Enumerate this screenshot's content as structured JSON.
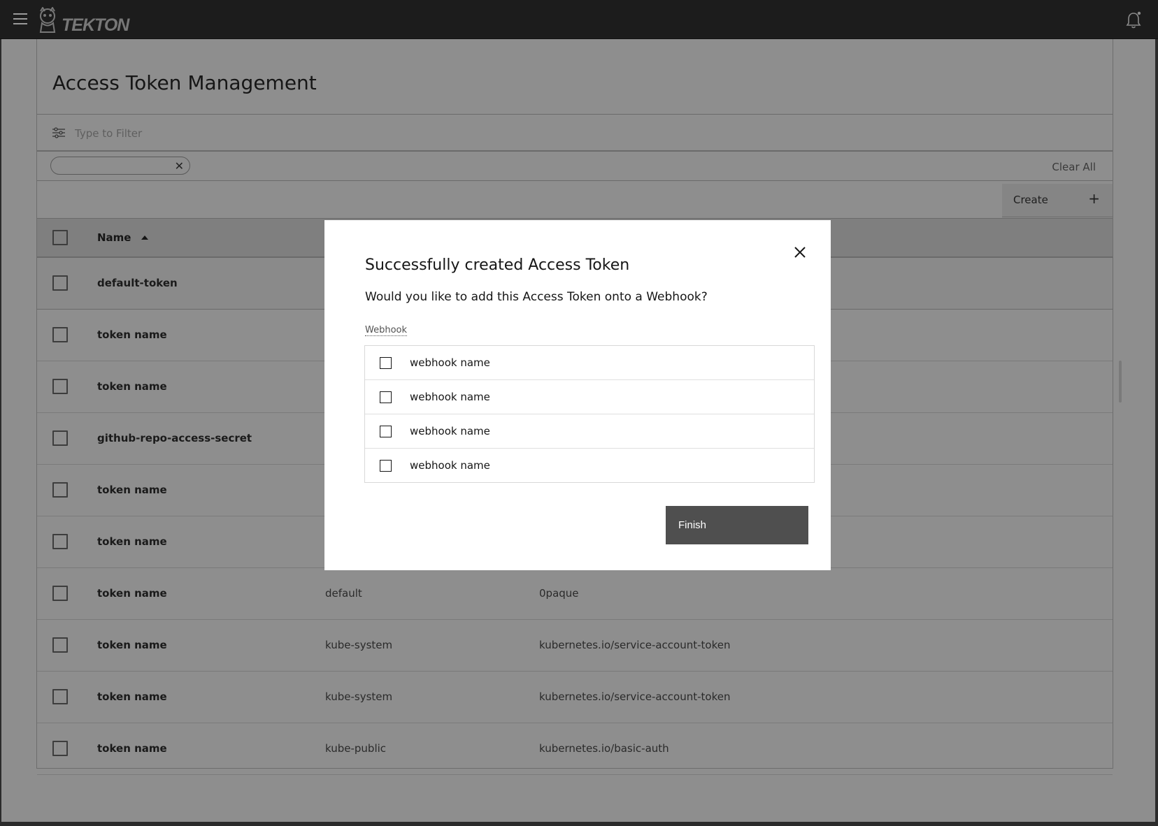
{
  "header": {
    "logo_text": "TEKTON"
  },
  "page": {
    "title": "Access Token Management",
    "filter_placeholder": "Type to Filter",
    "clear_all": "Clear All",
    "create_label": "Create",
    "create_plus": "+",
    "tag_close": "✕"
  },
  "table": {
    "columns": [
      "Name"
    ],
    "rows": [
      {
        "name": "default-token",
        "namespace": "",
        "type": ""
      },
      {
        "name": "token name",
        "namespace": "",
        "type": ""
      },
      {
        "name": "token name",
        "namespace": "",
        "type": ""
      },
      {
        "name": "github-repo-access-secret",
        "namespace": "",
        "type": ""
      },
      {
        "name": "token name",
        "namespace": "",
        "type": ""
      },
      {
        "name": "token name",
        "namespace": "",
        "type": ""
      },
      {
        "name": "token name",
        "namespace": "default",
        "type": "0paque"
      },
      {
        "name": "token name",
        "namespace": "kube-system",
        "type": "kubernetes.io/service-account-token"
      },
      {
        "name": "token name",
        "namespace": "kube-system",
        "type": "kubernetes.io/service-account-token"
      },
      {
        "name": "token name",
        "namespace": "kube-public",
        "type": "kubernetes.io/basic-auth"
      }
    ]
  },
  "modal": {
    "title": "Successfully created Access Token",
    "question": "Would you like to add this Access Token onto a Webhook?",
    "webhook_label": "Webhook",
    "webhooks": [
      "webhook name",
      "webhook name",
      "webhook name",
      "webhook name"
    ],
    "finish_label": "Finish"
  }
}
